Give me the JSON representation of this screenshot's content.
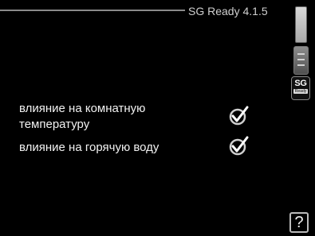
{
  "header": {
    "title": "SG Ready 4.1.5"
  },
  "settings": [
    {
      "label": "влияние на комнатную температуру",
      "checked": true
    },
    {
      "label": "влияние на горячую воду",
      "checked": true
    }
  ],
  "side_icons": {
    "sg_badge_main": "SG",
    "sg_badge_sub": "Ready"
  },
  "help": {
    "label": "?"
  }
}
